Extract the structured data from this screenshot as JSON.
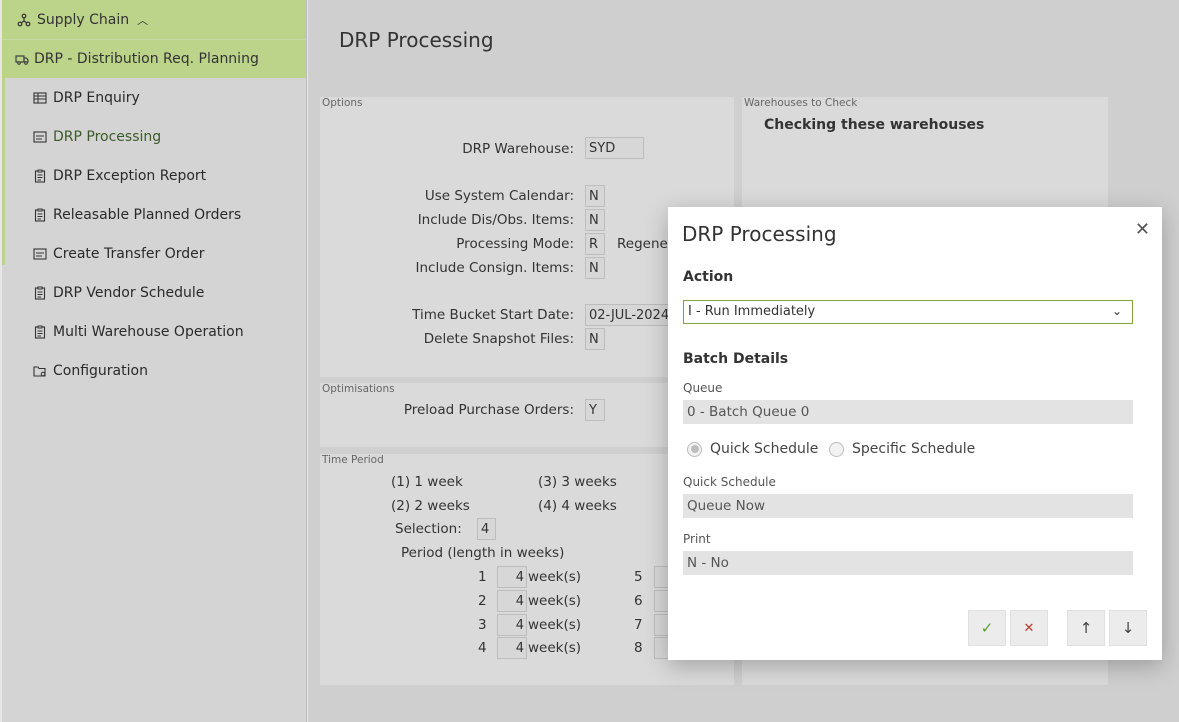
{
  "sidebar": {
    "module": "Supply Chain",
    "submodule": "DRP - Distribution Req. Planning",
    "items": [
      {
        "label": "DRP Enquiry"
      },
      {
        "label": "DRP Processing"
      },
      {
        "label": "DRP Exception Report"
      },
      {
        "label": "Releasable Planned Orders"
      },
      {
        "label": "Create Transfer Order"
      },
      {
        "label": "DRP Vendor Schedule"
      },
      {
        "label": "Multi Warehouse Operation"
      },
      {
        "label": "Configuration"
      }
    ],
    "active_item": "DRP Processing",
    "accent_color": "#bcd48a"
  },
  "page": {
    "title": "DRP Processing"
  },
  "options": {
    "panel_title": "Options",
    "warehouse_label": "DRP Warehouse:",
    "warehouse_value": "SYD",
    "system_calendar_label": "Use System Calendar:",
    "system_calendar_value": "N",
    "dis_obs_label": "Include Dis/Obs. Items:",
    "dis_obs_value": "N",
    "processing_mode_label": "Processing Mode:",
    "processing_mode_value": "R",
    "processing_mode_desc": "Regener",
    "consign_label": "Include Consign. Items:",
    "consign_value": "N",
    "bucket_start_label": "Time Bucket Start Date:",
    "bucket_start_value": "02-JUL-2024",
    "delete_snapshot_label": "Delete Snapshot Files:",
    "delete_snapshot_value": "N"
  },
  "warehouses": {
    "panel_title": "Warehouses to Check",
    "heading": "Checking these warehouses"
  },
  "optimisations": {
    "panel_title": "Optimisations",
    "preload_label": "Preload Purchase Orders:",
    "preload_value": "Y"
  },
  "time_period": {
    "panel_title": "Time Period",
    "opt1": "(1) 1 week",
    "opt2": "(2) 2 weeks",
    "opt3": "(3) 3 weeks",
    "opt4": "(4) 4 weeks",
    "selection_label": "Selection:",
    "selection_value": "4",
    "period_label": "Period (length in weeks)",
    "unit": "week(s)",
    "periods": [
      {
        "num": "1",
        "value": "4"
      },
      {
        "num": "2",
        "value": "4"
      },
      {
        "num": "3",
        "value": "4"
      },
      {
        "num": "4",
        "value": "4"
      }
    ],
    "periods_right": [
      "5",
      "6",
      "7",
      "8"
    ]
  },
  "modal": {
    "title": "DRP Processing",
    "action_label": "Action",
    "action_value": "I - Run Immediately",
    "batch_label": "Batch Details",
    "queue_label": "Queue",
    "queue_value": "0 - Batch Queue 0",
    "radio_quick": "Quick Schedule",
    "radio_specific": "Specific Schedule",
    "selected_radio": "Quick Schedule",
    "quick_schedule_label": "Quick Schedule",
    "quick_schedule_value": "Queue Now",
    "print_label": "Print",
    "print_value": "N - No",
    "ok_icon": "check-icon",
    "cancel_icon": "x-icon",
    "up_icon": "arrow-up-icon",
    "down_icon": "arrow-down-icon",
    "ok_color": "#5a9e2f",
    "cancel_color": "#c0392b"
  }
}
